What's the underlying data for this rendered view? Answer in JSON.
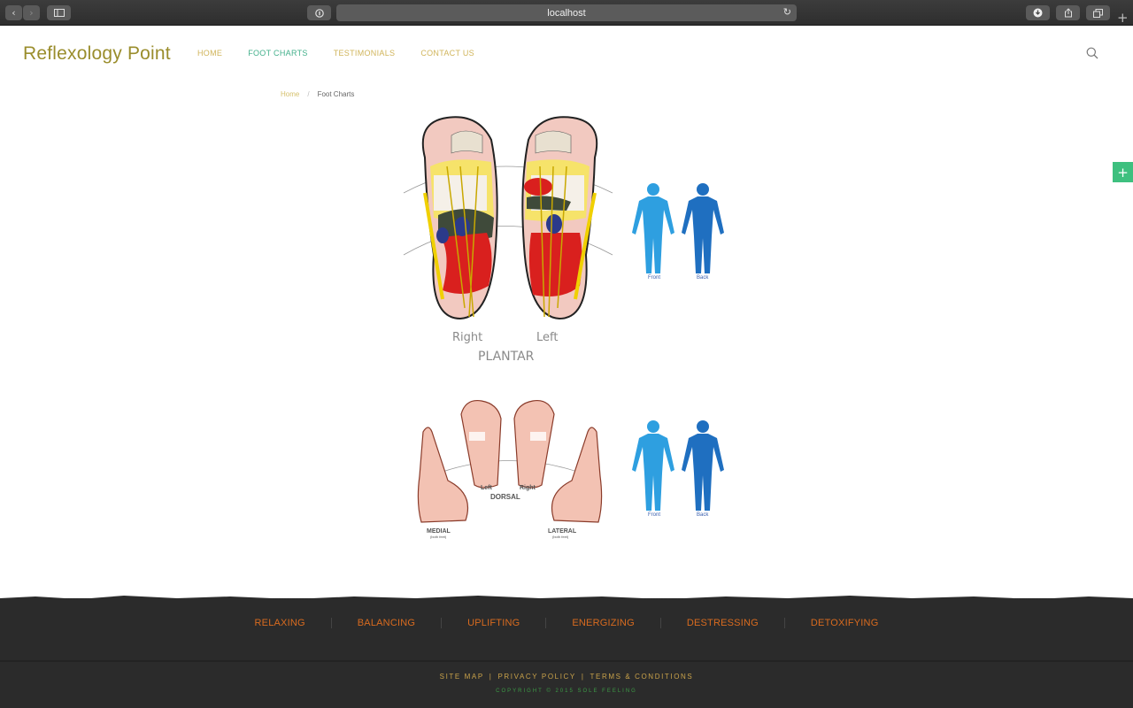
{
  "browser": {
    "url": "localhost"
  },
  "site": {
    "logo": "Reflexology Point",
    "nav": [
      {
        "label": "HOME"
      },
      {
        "label": "FOOT CHARTS"
      },
      {
        "label": "TESTIMONIALS"
      },
      {
        "label": "CONTACT US"
      }
    ]
  },
  "breadcrumb": {
    "home": "Home",
    "separator": "/",
    "current": "Foot Charts"
  },
  "plantar_chart": {
    "right": "Right",
    "left": "Left",
    "title": "PLANTAR",
    "body_front": "Front",
    "body_back": "Back"
  },
  "dorsal_chart": {
    "left": "Left",
    "right": "Right",
    "dorsal": "DORSAL",
    "medial": "MEDIAL",
    "medial_sub": "(both feet)",
    "lateral": "LATERAL",
    "lateral_sub": "(both feet)",
    "body_front": "Front",
    "body_back": "Back"
  },
  "footer": {
    "categories": [
      "RELAXING",
      "BALANCING",
      "UPLIFTING",
      "ENERGIZING",
      "DESTRESSING",
      "DETOXIFYING"
    ],
    "links": [
      "SITE MAP",
      "PRIVACY POLICY",
      "TERMS & CONDITIONS"
    ],
    "separator": "|",
    "copyright": "COPYRIGHT © 2015 SOLE FEELING"
  },
  "colors": {
    "logo": "#9a8d2c",
    "nav": "#d0b45a",
    "nav_active": "#43b08b",
    "footer_bg": "#2b2b2b",
    "footer_category": "#d96b1f",
    "footer_links": "#c9a24a",
    "copyright": "#3c9a46",
    "body_front": "#2e9fe0",
    "body_back": "#1f6fc0"
  }
}
